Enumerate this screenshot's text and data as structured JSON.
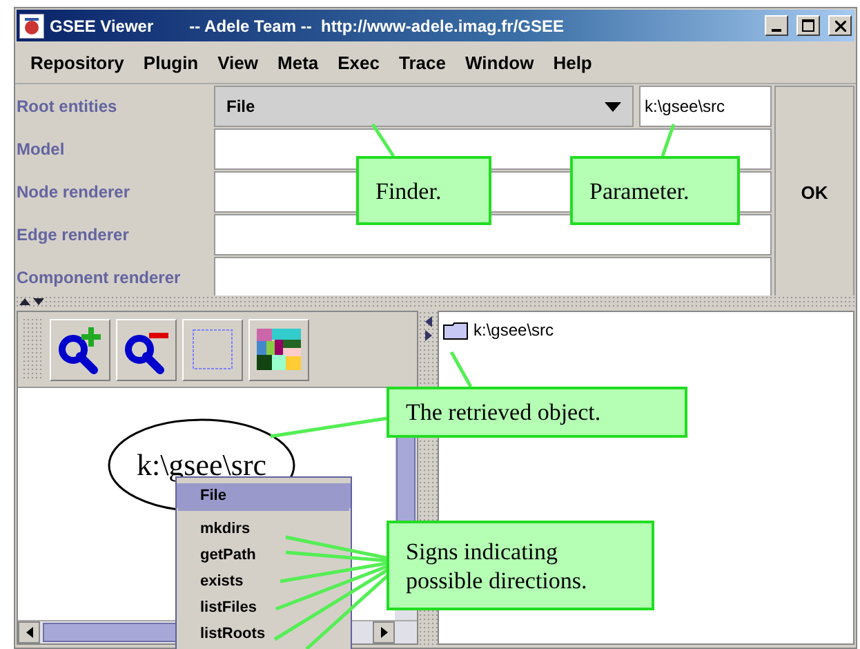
{
  "window": {
    "title": "GSEE Viewer",
    "subtitle": "-- Adele Team --  http://www-adele.imag.fr/GSEE"
  },
  "menu": [
    "Repository",
    "Plugin",
    "View",
    "Meta",
    "Exec",
    "Trace",
    "Window",
    "Help"
  ],
  "form": {
    "rows": [
      {
        "label": "Root entities",
        "kind": "combo",
        "value": "File",
        "parameter": "k:\\gsee\\src"
      },
      {
        "label": "Model",
        "kind": "text"
      },
      {
        "label": "Node renderer",
        "kind": "text"
      },
      {
        "label": "Edge renderer",
        "kind": "text"
      },
      {
        "label": "Component renderer",
        "kind": "text"
      }
    ],
    "ok": "OK"
  },
  "toolbar": [
    {
      "kind": "zoom-in"
    },
    {
      "kind": "zoom-out"
    },
    {
      "kind": "select"
    },
    {
      "kind": "layout"
    }
  ],
  "graph": {
    "node": "k:\\gsee\\src"
  },
  "popup": {
    "items": [
      {
        "label": "File",
        "kind": "header",
        "selected": true
      },
      {
        "label": "mkdirs",
        "kind": "item",
        "selected": false
      },
      {
        "label": "getPath",
        "kind": "item",
        "selected": false
      },
      {
        "label": "exists",
        "kind": "item",
        "selected": false
      },
      {
        "label": "listFiles",
        "kind": "item",
        "selected": false
      },
      {
        "label": "listRoots",
        "kind": "item",
        "selected": false
      }
    ]
  },
  "tree": [
    {
      "label": "k:\\gsee\\src"
    }
  ],
  "callouts": [
    {
      "text": "Finder."
    },
    {
      "text": "Parameter."
    },
    {
      "text": "The retrieved object."
    },
    {
      "text": "Signs indicating possible directions."
    }
  ]
}
